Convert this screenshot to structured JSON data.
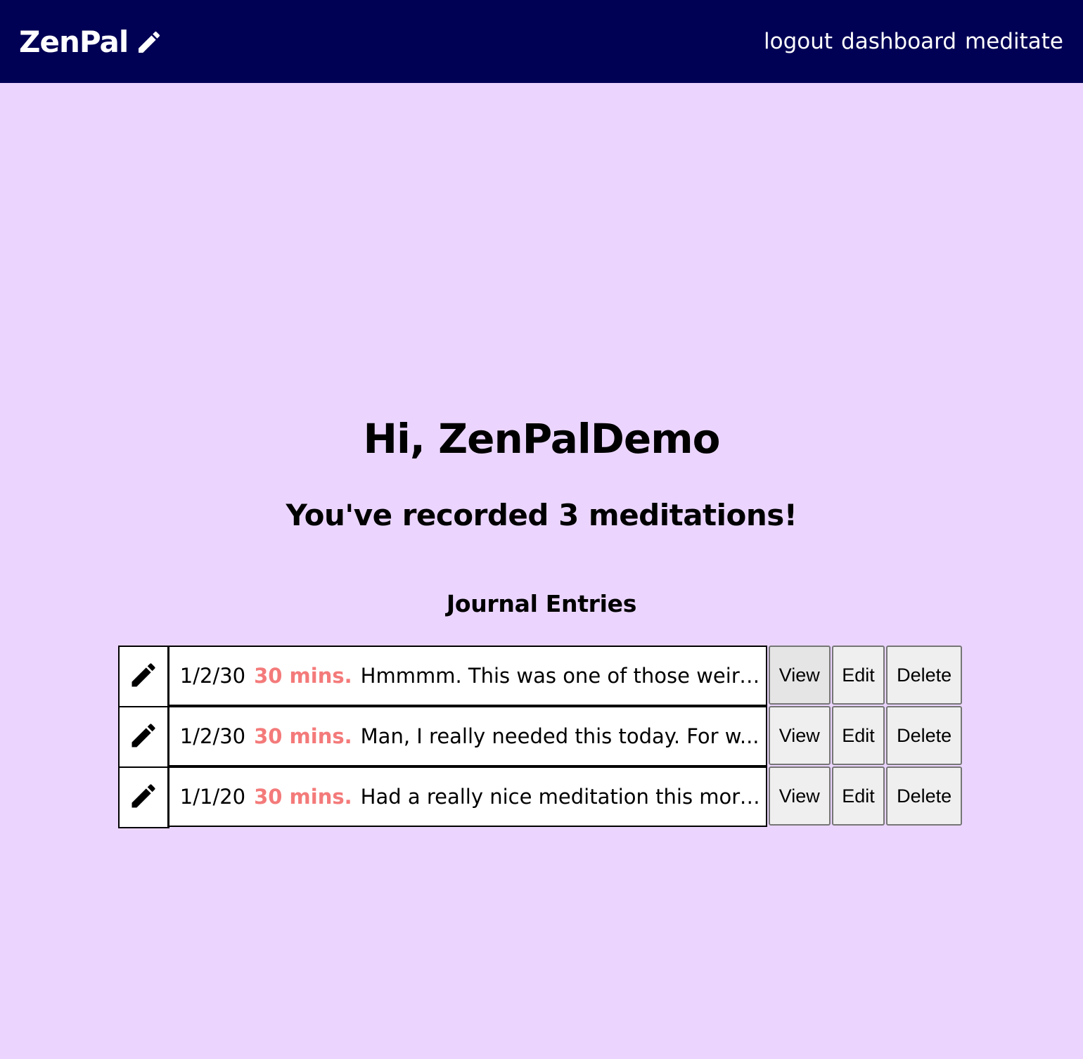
{
  "nav": {
    "brand": "ZenPal",
    "brand_icon": "pencil-icon",
    "links": [
      "logout",
      "dashboard",
      "meditate"
    ]
  },
  "greeting": "Hi, ZenPalDemo",
  "summary": "You've recorded 3 meditations!",
  "journal": {
    "title": "Journal Entries",
    "entry_icon": "pencil-icon",
    "entries": [
      {
        "date": "1/2/30",
        "duration": "30 mins.",
        "excerpt": "Hmmmm. This was one of those weird...",
        "view_label": "View",
        "edit_label": "Edit",
        "delete_label": "Delete"
      },
      {
        "date": "1/2/30",
        "duration": "30 mins.",
        "excerpt": "Man, I really needed this today. For w...",
        "view_label": "View",
        "edit_label": "Edit",
        "delete_label": "Delete"
      },
      {
        "date": "1/1/20",
        "duration": "30 mins.",
        "excerpt": "Had a really nice meditation this morni...",
        "view_label": "View",
        "edit_label": "Edit",
        "delete_label": "Delete"
      }
    ]
  },
  "colors": {
    "background": "#ebd5fe",
    "navbar": "#000055",
    "duration": "#f47a7a",
    "button_bg": "#efefef"
  }
}
